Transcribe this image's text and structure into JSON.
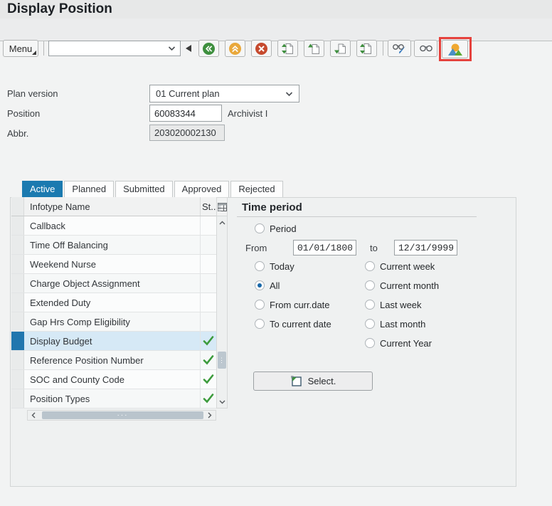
{
  "header": {
    "title": "Display Position"
  },
  "toolbar": {
    "menu_label": "Menu",
    "command_field_value": "",
    "icons": [
      "back-icon",
      "exit-icon",
      "cancel-icon",
      "first-page-icon",
      "previous-page-icon",
      "next-page-icon",
      "last-page-icon",
      "display-change-icon",
      "display-icon",
      "overview-icon"
    ],
    "highlighted_icon": "overview-icon"
  },
  "form": {
    "plan_version": {
      "label": "Plan version",
      "value": "01 Current plan"
    },
    "position": {
      "label": "Position",
      "value": "60083344",
      "description": "Archivist I"
    },
    "abbr": {
      "label": "Abbr.",
      "value": "203020002130"
    }
  },
  "tabs": [
    {
      "label": "Active",
      "active": true
    },
    {
      "label": "Planned",
      "active": false
    },
    {
      "label": "Submitted",
      "active": false
    },
    {
      "label": "Approved",
      "active": false
    },
    {
      "label": "Rejected",
      "active": false
    }
  ],
  "table": {
    "columns": {
      "name": "Infotype Name",
      "status": "St.."
    },
    "rows": [
      {
        "name": "Callback",
        "checked": false,
        "selected": false
      },
      {
        "name": "Time Off Balancing",
        "checked": false,
        "selected": false
      },
      {
        "name": "Weekend Nurse",
        "checked": false,
        "selected": false
      },
      {
        "name": "Charge Object Assignment",
        "checked": false,
        "selected": false
      },
      {
        "name": "Extended Duty",
        "checked": false,
        "selected": false
      },
      {
        "name": "Gap Hrs Comp Eligibility",
        "checked": false,
        "selected": false
      },
      {
        "name": "Display Budget",
        "checked": true,
        "selected": true
      },
      {
        "name": "Reference Position Number",
        "checked": true,
        "selected": false
      },
      {
        "name": "SOC and County Code",
        "checked": true,
        "selected": false
      },
      {
        "name": "Position Types",
        "checked": true,
        "selected": false
      }
    ]
  },
  "time_period": {
    "title": "Time period",
    "from_label": "From",
    "from_value": "01/01/1800",
    "to_label": "to",
    "to_value": "12/31/9999",
    "radios_left": [
      {
        "label": "Period",
        "selected": false
      },
      {
        "label": "Today",
        "selected": false
      },
      {
        "label": "All",
        "selected": true
      },
      {
        "label": "From curr.date",
        "selected": false
      },
      {
        "label": "To current date",
        "selected": false
      }
    ],
    "radios_right": [
      {
        "label": "Current week",
        "selected": false
      },
      {
        "label": "Current month",
        "selected": false
      },
      {
        "label": "Last week",
        "selected": false
      },
      {
        "label": "Last month",
        "selected": false
      },
      {
        "label": "Current Year",
        "selected": false
      }
    ],
    "select_button": "Select."
  },
  "colors": {
    "accent_blue": "#1b7ab0",
    "selected_row_blue": "#d6e9f6",
    "check_green": "#3c9b3c",
    "highlight_red": "#e5413c"
  }
}
